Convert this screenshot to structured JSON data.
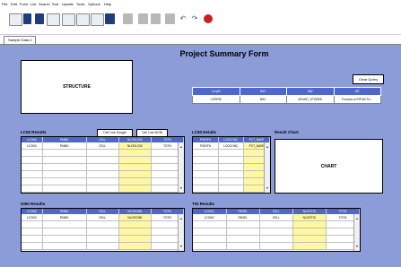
{
  "menu": [
    "File",
    "Edit",
    "Form",
    "List",
    "Search",
    "Sort",
    "Update",
    "Tools",
    "Options",
    "Help"
  ],
  "toolbar": {
    "undo_glyph": "↶",
    "redo_glyph": "↷",
    "icons": [
      "new-record-icon",
      "find-icon",
      "list-icon",
      "table-icon",
      "form-view-icon",
      "records-icon",
      "database-icon",
      "pen-icon",
      "cut-icon",
      "copy-icon",
      "paste-icon",
      "delete-icon",
      "undo-icon",
      "redo-icon",
      "exit-icon"
    ]
  },
  "tab": "Sample Data 2",
  "title": "Project Summary Form",
  "structure_label": "STRUCTURE",
  "clear_query_label": "Clear Query",
  "info_table": {
    "headers": [
      "CorpID",
      "NSC",
      "MW",
      "MF"
    ],
    "row": [
      "CORPID",
      "NSC",
      "MOLWT_STORED",
      "Formula of STRUCTU..."
    ]
  },
  "lc50": {
    "label": "LC50 Results",
    "btn_google": "Cell Line Google",
    "btn_ncbi": "Cell Line NCBI",
    "headers": [
      "LCONC",
      "PANEL",
      "CELL",
      "NLOGLC50",
      "TOTN"
    ],
    "row": [
      "LCONC",
      "PANEL",
      "CELL",
      "NLOGLC50",
      "TOTN"
    ]
  },
  "lc50_details": {
    "label": "LC50 Details",
    "headers": [
      "POINTN",
      "LOGCONC",
      "PCT_NAVE"
    ],
    "row": [
      "POINTN",
      "LOGCONC",
      "PCT_NAVE"
    ]
  },
  "result_chart": {
    "label": "Result Chart",
    "placeholder": "CHART"
  },
  "gi50": {
    "label": "GI50 Results",
    "headers": [
      "LCONC",
      "PANEL",
      "CELL",
      "NLOGGI50",
      "TOTN"
    ],
    "row": [
      "LCONC",
      "PANEL",
      "CELL",
      "NLOGGI50",
      "TOTN"
    ]
  },
  "tgi": {
    "label": "TGI Results",
    "headers": [
      "LCONC",
      "PANEL",
      "CELL",
      "NLOGTGI",
      "TOTN"
    ],
    "row": [
      "LCONC",
      "PANEL",
      "CELL",
      "NLOGTGI",
      "TOTN"
    ]
  },
  "colors": {
    "form_bg": "#8c9cd8",
    "header_bg": "#4d68c8",
    "highlight": "#fff8a0"
  }
}
